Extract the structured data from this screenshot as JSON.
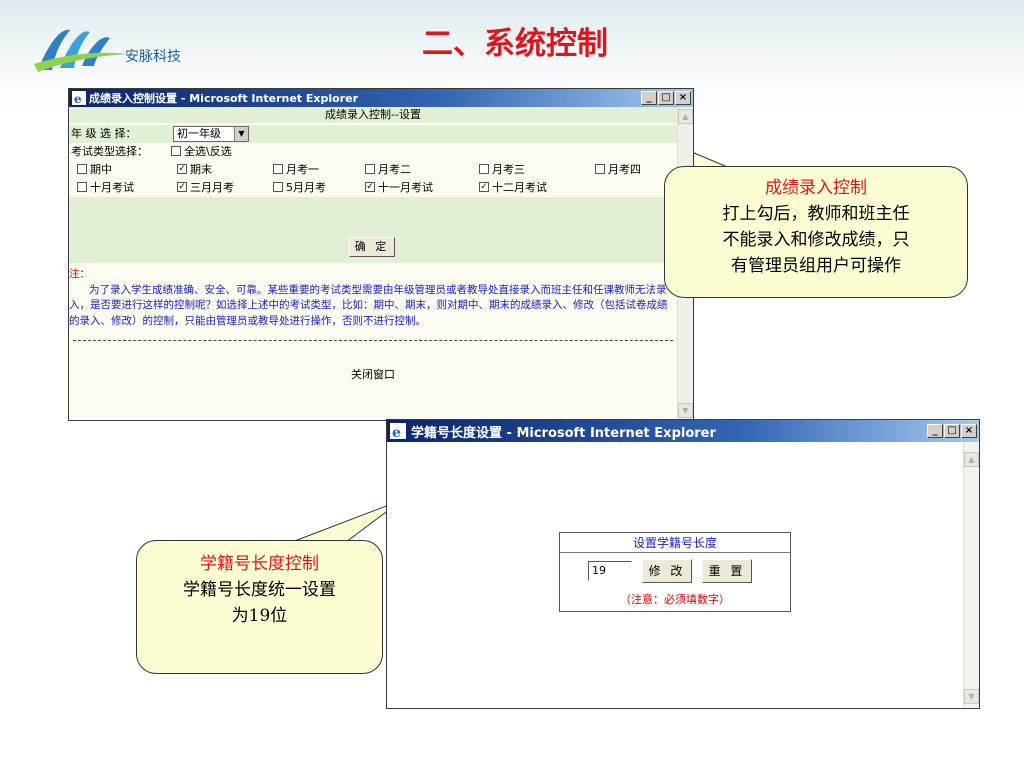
{
  "slide": {
    "title": "二、系统控制",
    "logo_text": "安脉科技"
  },
  "window_grade": {
    "title": "成绩录入控制设置 - Microsoft Internet Explorer",
    "header": "成绩录入控制--设置",
    "grade_label": "年 级 选 择：",
    "grade_value": "初一年级",
    "type_label": "考试类型选择：",
    "select_all_label": "全选\\反选",
    "select_all_checked": false,
    "exam_types": [
      {
        "label": "期中",
        "checked": false
      },
      {
        "label": "期末",
        "checked": true
      },
      {
        "label": "月考一",
        "checked": false
      },
      {
        "label": "月考二",
        "checked": false
      },
      {
        "label": "月考三",
        "checked": false
      },
      {
        "label": "月考四",
        "checked": false
      },
      {
        "label": "十月考试",
        "checked": false
      },
      {
        "label": "三月月考",
        "checked": true
      },
      {
        "label": "5月月考",
        "checked": false
      },
      {
        "label": "十一月考试",
        "checked": true
      },
      {
        "label": "十二月考试",
        "checked": true
      }
    ],
    "confirm_label": "确 定",
    "note_label": "注：",
    "note_text": "为了录入学生成绩准确、安全、可靠。某些重要的考试类型需要由年级管理员或者教导处直接录入而班主任和任课教师无法录入，是否要进行这样的控制呢？如选择上述中的考试类型，比如：期中、期末，则对期中、期末的成绩录入、修改（包括试卷成绩的录入、修改）的控制，只能由管理员或教导处进行操作，否则不进行控制。",
    "close_label": "关闭窗口"
  },
  "window_student_id": {
    "title": "学籍号长度设置 - Microsoft Internet Explorer",
    "panel_title": "设置学籍号长度",
    "length_value": "19",
    "modify_label": "修 改",
    "reset_label": "重 置",
    "panel_note": "（注意：必须填数字）"
  },
  "callout_grade": {
    "title": "成绩录入控制",
    "line1": "打上勾后，教师和班主任",
    "line2": "不能录入和修改成绩，只",
    "line3": "有管理员组用户可操作"
  },
  "callout_student_id": {
    "title": "学籍号长度控制",
    "line1": "学籍号长度统一设置",
    "line2": "为19位"
  },
  "colors": {
    "title_red": "#e0141b",
    "note_blue": "#1a22c6",
    "band_green": "#e3efd4",
    "callout_yellow": "#fdfdd4",
    "titlebar_blue": "#0a246a"
  }
}
